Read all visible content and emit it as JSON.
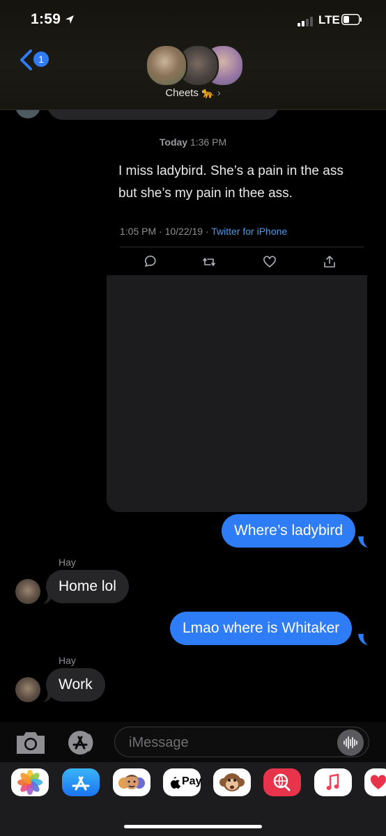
{
  "status": {
    "time": "1:59",
    "network": "LTE"
  },
  "header": {
    "back_badge": "1",
    "group_name": "Cheets 🐆",
    "chevron": "›"
  },
  "tweet": {
    "timestamp_day": "Today",
    "timestamp_time": "1:36 PM",
    "text": "I miss ladybird. She’s a pain in the ass but she’s my pain in thee ass.",
    "meta_time": "1:05 PM · 10/22/19 · ",
    "meta_source": "Twitter for iPhone"
  },
  "messages": [
    {
      "direction": "out",
      "text": "Where’s ladybird"
    },
    {
      "direction": "in",
      "sender": "Hay",
      "text": "Home lol"
    },
    {
      "direction": "out",
      "text": "Lmao where is Whitaker"
    },
    {
      "direction": "in",
      "sender": "Hay",
      "text": "Work"
    }
  ],
  "input": {
    "placeholder": "iMessage"
  },
  "apple_pay_label": "Pay",
  "colors": {
    "outgoing_bubble": "#2e7cf6",
    "incoming_bubble": "#262628",
    "link": "#4a9ae8"
  },
  "icons": [
    "location-arrow-icon",
    "signal-icon",
    "battery-icon",
    "back-chevron-icon",
    "reply-icon",
    "retweet-icon",
    "like-icon",
    "share-icon",
    "camera-icon",
    "app-store-icon",
    "audio-waveform-icon",
    "photos-icon",
    "memoji-icon",
    "apple-pay-icon",
    "animoji-icon",
    "web-search-icon",
    "music-icon",
    "digital-touch-icon"
  ]
}
